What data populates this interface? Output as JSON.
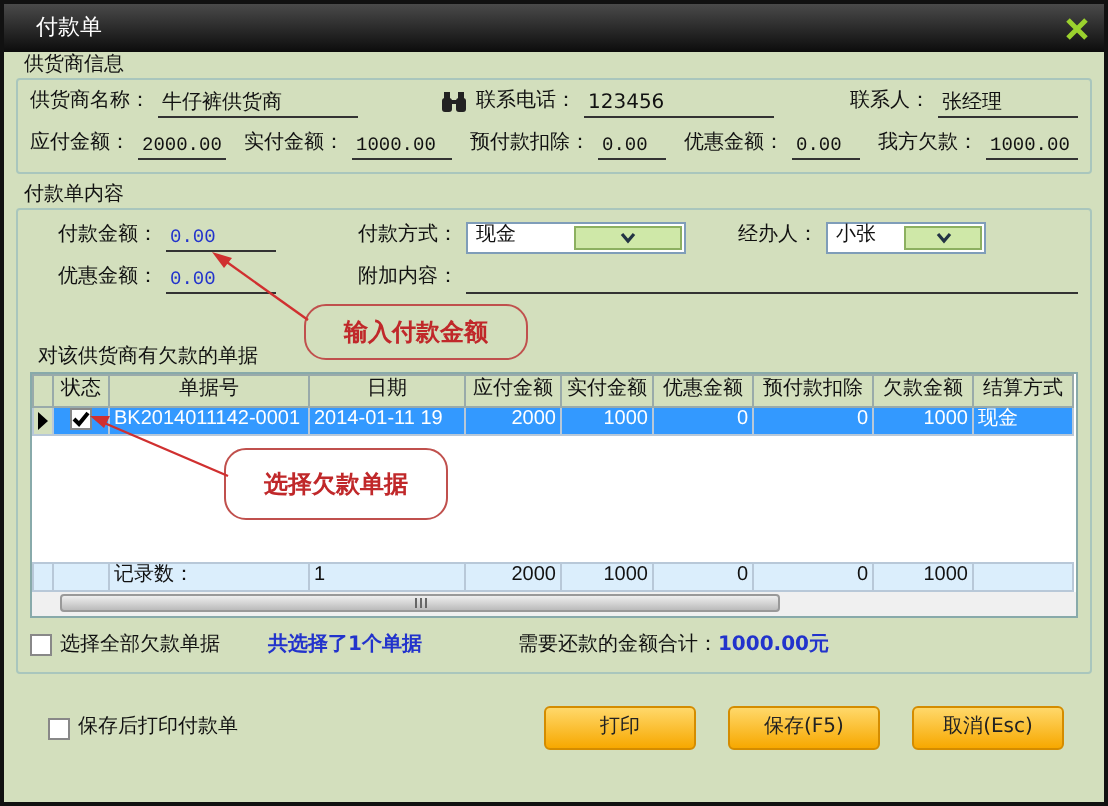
{
  "window": {
    "title": "付款单"
  },
  "supplier_info": {
    "legend": "供货商信息",
    "name": {
      "label": "供货商名称：",
      "value": "牛仔裤供货商"
    },
    "phone": {
      "label": "联系电话：",
      "value": "123456"
    },
    "contact": {
      "label": "联系人：",
      "value": "张经理"
    },
    "amounts": [
      {
        "label": "应付金额：",
        "value": "2000.00"
      },
      {
        "label": "实付金额：",
        "value": "1000.00"
      },
      {
        "label": "预付款扣除：",
        "value": "0.00"
      },
      {
        "label": "优惠金额：",
        "value": "0.00"
      },
      {
        "label": "我方欠款：",
        "value": "1000.00"
      }
    ]
  },
  "payment": {
    "legend": "付款单内容",
    "amount": {
      "label": "付款金额：",
      "value": "0.00"
    },
    "method": {
      "label": "付款方式：",
      "value": "现金"
    },
    "handler": {
      "label": "经办人：",
      "value": "小张"
    },
    "discount": {
      "label": "优惠金额：",
      "value": "0.00"
    },
    "note": {
      "label": "附加内容："
    }
  },
  "callouts": [
    {
      "text": "输入付款金额"
    },
    {
      "text": "选择欠款单据"
    }
  ],
  "bills": {
    "title": "对该供货商有欠款的单据",
    "status_column": "状态",
    "columns": [
      "单据号",
      "日期",
      "应付金额",
      "实付金额",
      "优惠金额",
      "预付款扣除",
      "欠款金额",
      "结算方式"
    ],
    "rows": [
      {
        "current": true,
        "selected": true,
        "checked": true,
        "cells": [
          "BK2014011142-0001",
          "2014-01-11 19",
          "2000",
          "1000",
          "0",
          "0",
          "1000",
          "现金"
        ]
      }
    ],
    "summary": {
      "label": "记录数：",
      "count": "1",
      "totals": [
        "2000",
        "1000",
        "0",
        "0",
        "1000"
      ]
    }
  },
  "select_all": {
    "label": "选择全部欠款单据",
    "checked": false
  },
  "selected_count": "共选择了1个单据",
  "total": {
    "label": "需要还款的金额合计：",
    "value": "1000.00元"
  },
  "print_after_save": {
    "label": "保存后打印付款单",
    "checked": false
  },
  "buttons": [
    "打印",
    "保存(F5)",
    "取消(Esc)"
  ]
}
